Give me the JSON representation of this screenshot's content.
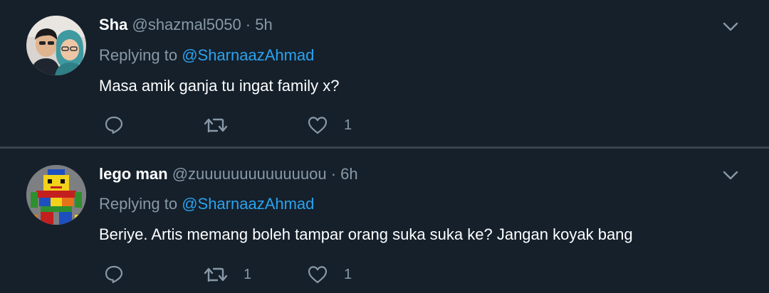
{
  "tweets": [
    {
      "display_name": "Sha",
      "handle": "@shazmal5050",
      "separator": " · ",
      "time": "5h",
      "replying_prefix": "Replying to ",
      "replying_to": "@SharnaazAhmad",
      "text": "Masa amik ganja tu ingat family x?",
      "reply_count": "",
      "retweet_count": "",
      "like_count": "1"
    },
    {
      "display_name": "lego man",
      "handle": "@zuuuuuuuuuuuuuou",
      "separator": " · ",
      "time": "6h",
      "replying_prefix": "Replying to ",
      "replying_to": "@SharnaazAhmad",
      "text": "Beriye. Artis memang boleh tampar orang suka suka ke? Jangan koyak bang",
      "reply_count": "",
      "retweet_count": "1",
      "like_count": "1"
    }
  ],
  "icons": {
    "reply": "reply-icon",
    "retweet": "retweet-icon",
    "like": "heart-icon",
    "more": "chevron-down-icon"
  },
  "colors": {
    "background": "#15202b",
    "divider": "#38444d",
    "text_primary": "#ffffff",
    "text_secondary": "#8899a6",
    "accent": "#2aa3ef"
  }
}
